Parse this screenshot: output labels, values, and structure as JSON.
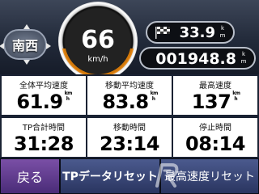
{
  "compass": {
    "heading": "南西"
  },
  "speedometer": {
    "speed": "66",
    "unit": "km/h"
  },
  "odometer": {
    "trip": {
      "value": "33.9",
      "unit_top": "k",
      "unit_bottom": "m"
    },
    "total": {
      "value": "001948.8",
      "unit_top": "k",
      "unit_bottom": "m"
    }
  },
  "stats": [
    {
      "label": "全体平均速度",
      "value": "61.9",
      "unit_top": "km",
      "unit_bottom": "h"
    },
    {
      "label": "移動平均速度",
      "value": "83.8",
      "unit_top": "km",
      "unit_bottom": "h"
    },
    {
      "label": "最高速度",
      "value": "137",
      "unit_top": "km",
      "unit_bottom": "h"
    },
    {
      "label": "TP合計時間",
      "value": "31:28"
    },
    {
      "label": "移動時間",
      "value": "23:14"
    },
    {
      "label": "停止時間",
      "value": "08:14"
    }
  ],
  "buttons": {
    "back": "戻る",
    "reset_trip": "TPデータリセット",
    "reset_max": "最高速度リセット"
  },
  "colors": {
    "accent_orange": "#e8840a",
    "button_purple": "#5f3c8f",
    "button_blue": "#3a467a"
  }
}
